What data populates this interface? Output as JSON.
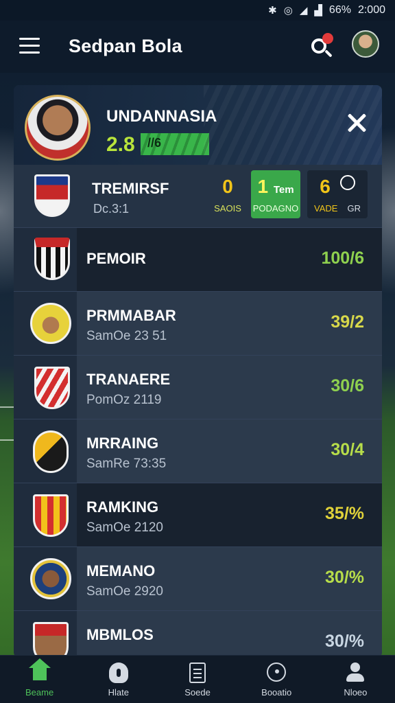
{
  "status_bar": {
    "battery": "66%",
    "time": "2:000"
  },
  "app_bar": {
    "title": "Sedpan Bola"
  },
  "featured": {
    "name": "UNDANNASIA",
    "score": "2.8",
    "badge": "//6"
  },
  "match": {
    "title": "TREMIRSF",
    "subtitle": "Dc.3:1",
    "stats": [
      {
        "value": "0",
        "label": "SAOIS"
      },
      {
        "value": "1",
        "value_suffix": "Tem",
        "label": "PODAGNO"
      },
      {
        "value": "6",
        "label": "VADE",
        "label2": "GR"
      }
    ]
  },
  "list": [
    {
      "name": "PEMOIR",
      "sub": "",
      "score": "100/6",
      "score_color": "#8fd14f"
    },
    {
      "name": "PRMMABAR",
      "sub": "SamOe 23 51",
      "score": "39/2",
      "score_color": "#d8d84a"
    },
    {
      "name": "TRANAERE",
      "sub": "PomOz 2119",
      "score": "30/6",
      "score_color": "#8fd14f"
    },
    {
      "name": "MRRAING",
      "sub": "SamRe 73:35",
      "score": "30/4",
      "score_color": "#b7dd4a"
    },
    {
      "name": "RAMKING",
      "sub": "SamOe 2120",
      "score": "35/%",
      "score_color": "#e0d23a"
    },
    {
      "name": "MEMANO",
      "sub": "SamOe 2920",
      "score": "30/%",
      "score_color": "#b7dd4a"
    },
    {
      "name": "MBMLOS",
      "sub": "",
      "score": "30/%",
      "score_color": "#c9d6e2"
    }
  ],
  "bottom_nav": [
    {
      "label": "Beame",
      "icon": "home-icon"
    },
    {
      "label": "Hlate",
      "icon": "mic-icon"
    },
    {
      "label": "Soede",
      "icon": "document-icon"
    },
    {
      "label": "Booatio",
      "icon": "location-icon"
    },
    {
      "label": "Nloeo",
      "icon": "profile-icon"
    }
  ],
  "colors": {
    "accent": "#4ec25a",
    "card": "#1f2c3d",
    "appbar": "#0e1b2b"
  }
}
